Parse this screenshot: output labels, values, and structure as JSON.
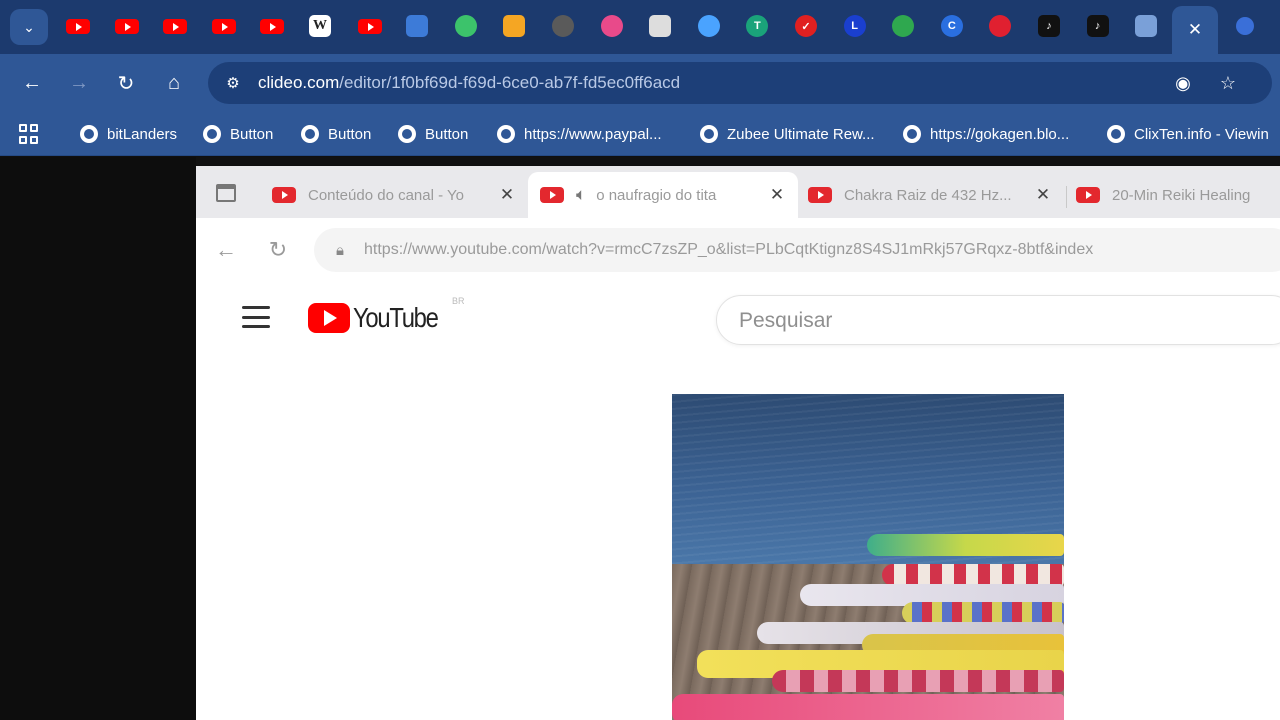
{
  "outer_browser": {
    "tab_strip": {
      "favicons": [
        {
          "icon": "youtube-icon",
          "color": "#ff0000"
        },
        {
          "icon": "youtube-icon",
          "color": "#ff0000"
        },
        {
          "icon": "youtube-icon",
          "color": "#ff0000"
        },
        {
          "icon": "youtube-icon",
          "color": "#ff0000"
        },
        {
          "icon": "youtube-icon",
          "color": "#ff0000"
        },
        {
          "icon": "wikipedia-icon",
          "color": "#ffffff",
          "glyph": "W"
        },
        {
          "icon": "youtube-icon",
          "color": "#ff0000"
        },
        {
          "icon": "globe-app-icon",
          "color": "#3d7bd8"
        },
        {
          "icon": "play-circle-icon",
          "color": "#3cc36b"
        },
        {
          "icon": "blogger-icon",
          "color": "#f5a623"
        },
        {
          "icon": "grey-circle-icon",
          "color": "#5a5a5a"
        },
        {
          "icon": "pink-circle-icon",
          "color": "#e84a8a"
        },
        {
          "icon": "page-icon",
          "color": "#dddddd"
        },
        {
          "icon": "blue-ring-icon",
          "color": "#4aa3ff"
        },
        {
          "icon": "teal-t-icon",
          "color": "#1aa37a",
          "glyph": "T"
        },
        {
          "icon": "red-check-icon",
          "color": "#e02020",
          "glyph": "✓"
        },
        {
          "icon": "blue-l-icon",
          "color": "#1a3fcf",
          "glyph": "L"
        },
        {
          "icon": "green-ring-icon",
          "color": "#2fa84f"
        },
        {
          "icon": "blue-c-icon",
          "color": "#2a6fe0",
          "glyph": "C"
        },
        {
          "icon": "red-c-icon",
          "color": "#e02030"
        },
        {
          "icon": "tiktok-icon",
          "color": "#111111",
          "glyph": "♪"
        },
        {
          "icon": "tiktok-icon",
          "color": "#111111",
          "glyph": "♪"
        },
        {
          "icon": "leaf-icon",
          "color": "#7aa0d8"
        }
      ],
      "active_tab_close": "✕"
    },
    "address": {
      "host": "clideo.com",
      "path": "/editor/1f0bf69d-f69d-6ce0-ab7f-fd5ec0ff6acd"
    },
    "bookmarks": [
      "bitLanders",
      "Button",
      "Button",
      "Button",
      "https://www.paypal...",
      "Zubee Ultimate Rew...",
      "https://gokagen.blo...",
      "ClixTen.info - Viewin"
    ]
  },
  "inner_browser": {
    "tabs": [
      {
        "title": "Conteúdo do canal - Yo",
        "active": false,
        "audio": false
      },
      {
        "title": "o naufragio do tita",
        "active": true,
        "audio": true
      },
      {
        "title": "Chakra Raiz de 432 Hz...",
        "active": false,
        "audio": false
      },
      {
        "title": "20-Min Reiki Healing",
        "active": false,
        "audio": false
      }
    ],
    "url": "https://www.youtube.com/watch?v=rmcC7zsZP_o&list=PLbCqtKtignz8S4SJ1mRkj57GRqxz-8btf&index",
    "youtube": {
      "logo_text": "YouTube",
      "country_code": "BR",
      "search_placeholder": "Pesquisar"
    }
  },
  "colors": {
    "chrome_dark": "#1c3a6e",
    "chrome": "#2f5796",
    "youtube_red": "#ff0000"
  }
}
